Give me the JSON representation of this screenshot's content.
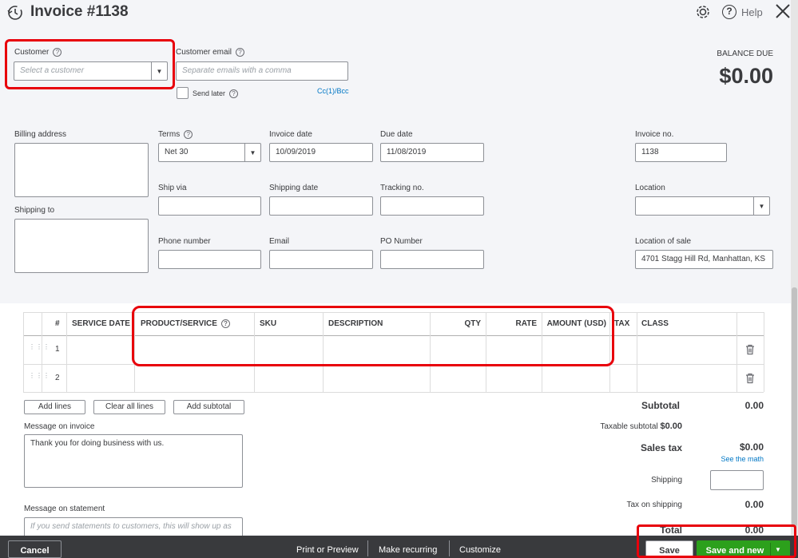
{
  "header": {
    "title": "Invoice #1138",
    "help_label": "Help"
  },
  "customer": {
    "label": "Customer",
    "placeholder": "Select a customer"
  },
  "customer_email": {
    "label": "Customer email",
    "placeholder": "Separate emails with a comma",
    "cc_bcc": "Cc(1)/Bcc",
    "send_later": "Send later"
  },
  "balance": {
    "label": "BALANCE DUE",
    "value": "$0.00"
  },
  "addresses": {
    "billing_label": "Billing address",
    "shipping_label": "Shipping to"
  },
  "fields": {
    "terms_label": "Terms",
    "terms_value": "Net 30",
    "invoice_date_label": "Invoice date",
    "invoice_date_value": "10/09/2019",
    "due_date_label": "Due date",
    "due_date_value": "11/08/2019",
    "invoice_no_label": "Invoice no.",
    "invoice_no_value": "1138",
    "ship_via_label": "Ship via",
    "shipping_date_label": "Shipping date",
    "tracking_label": "Tracking no.",
    "location_label": "Location",
    "phone_label": "Phone number",
    "email_label": "Email",
    "po_label": "PO Number",
    "location_sale_label": "Location of sale",
    "location_sale_value": "4701 Stagg Hill Rd, Manhattan, KS"
  },
  "table": {
    "columns": [
      "#",
      "SERVICE DATE",
      "PRODUCT/SERVICE",
      "SKU",
      "DESCRIPTION",
      "QTY",
      "RATE",
      "AMOUNT (USD)",
      "TAX",
      "CLASS"
    ],
    "rows": [
      "1",
      "2"
    ]
  },
  "buttons": {
    "add_lines": "Add lines",
    "clear_all_lines": "Clear all lines",
    "add_subtotal": "Add subtotal"
  },
  "messages": {
    "invoice_label": "Message on invoice",
    "invoice_value": "Thank you for doing business with us.",
    "statement_label": "Message on statement",
    "statement_placeholder": "If you send statements to customers, this will show up as"
  },
  "totals": {
    "subtotal_label": "Subtotal",
    "subtotal_value": "0.00",
    "taxable_label": "Taxable subtotal",
    "taxable_value": "$0.00",
    "sales_tax_label": "Sales tax",
    "sales_tax_value": "$0.00",
    "see_math": "See the math",
    "shipping_label": "Shipping",
    "tax_shipping_label": "Tax on shipping",
    "tax_shipping_value": "0.00",
    "total_label": "Total",
    "total_value": "0.00"
  },
  "footer": {
    "cancel": "Cancel",
    "print_preview": "Print or Preview",
    "make_recurring": "Make recurring",
    "customize": "Customize",
    "save": "Save",
    "save_new": "Save and new"
  },
  "colors": {
    "green": "#2ca01c",
    "footer_bg": "#393a3d",
    "highlight_red": "#e8000b",
    "link_blue": "#0077c5"
  }
}
